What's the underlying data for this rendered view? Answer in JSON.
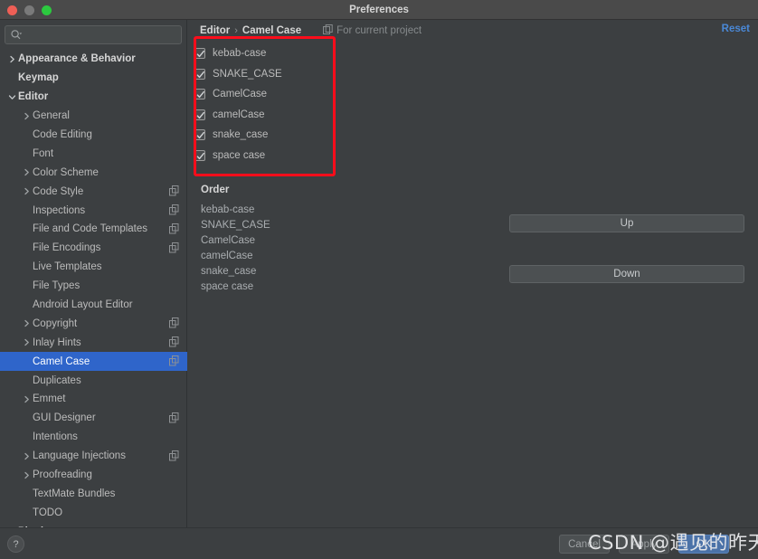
{
  "window": {
    "title": "Preferences",
    "traffic_lights": [
      "close-red",
      "minimize-gray",
      "maximize-green"
    ]
  },
  "sidebar": {
    "search": {
      "value": "",
      "placeholder": "",
      "icon": "search-icon"
    },
    "items": [
      {
        "label": "Appearance & Behavior",
        "indent": 0,
        "twisty": "collapsed",
        "bold": true,
        "cfg": false,
        "selected": false
      },
      {
        "label": "Keymap",
        "indent": 0,
        "twisty": "none",
        "bold": true,
        "cfg": false,
        "selected": false
      },
      {
        "label": "Editor",
        "indent": 0,
        "twisty": "expanded",
        "bold": true,
        "cfg": false,
        "selected": false
      },
      {
        "label": "General",
        "indent": 1,
        "twisty": "collapsed",
        "bold": false,
        "cfg": false,
        "selected": false
      },
      {
        "label": "Code Editing",
        "indent": 1,
        "twisty": "none",
        "bold": false,
        "cfg": false,
        "selected": false
      },
      {
        "label": "Font",
        "indent": 1,
        "twisty": "none",
        "bold": false,
        "cfg": false,
        "selected": false
      },
      {
        "label": "Color Scheme",
        "indent": 1,
        "twisty": "collapsed",
        "bold": false,
        "cfg": false,
        "selected": false
      },
      {
        "label": "Code Style",
        "indent": 1,
        "twisty": "collapsed",
        "bold": false,
        "cfg": true,
        "selected": false
      },
      {
        "label": "Inspections",
        "indent": 1,
        "twisty": "none",
        "bold": false,
        "cfg": true,
        "selected": false
      },
      {
        "label": "File and Code Templates",
        "indent": 1,
        "twisty": "none",
        "bold": false,
        "cfg": true,
        "selected": false
      },
      {
        "label": "File Encodings",
        "indent": 1,
        "twisty": "none",
        "bold": false,
        "cfg": true,
        "selected": false
      },
      {
        "label": "Live Templates",
        "indent": 1,
        "twisty": "none",
        "bold": false,
        "cfg": false,
        "selected": false
      },
      {
        "label": "File Types",
        "indent": 1,
        "twisty": "none",
        "bold": false,
        "cfg": false,
        "selected": false
      },
      {
        "label": "Android Layout Editor",
        "indent": 1,
        "twisty": "none",
        "bold": false,
        "cfg": false,
        "selected": false
      },
      {
        "label": "Copyright",
        "indent": 1,
        "twisty": "collapsed",
        "bold": false,
        "cfg": true,
        "selected": false
      },
      {
        "label": "Inlay Hints",
        "indent": 1,
        "twisty": "collapsed",
        "bold": false,
        "cfg": true,
        "selected": false
      },
      {
        "label": "Camel Case",
        "indent": 1,
        "twisty": "none",
        "bold": false,
        "cfg": true,
        "selected": true
      },
      {
        "label": "Duplicates",
        "indent": 1,
        "twisty": "none",
        "bold": false,
        "cfg": false,
        "selected": false
      },
      {
        "label": "Emmet",
        "indent": 1,
        "twisty": "collapsed",
        "bold": false,
        "cfg": false,
        "selected": false
      },
      {
        "label": "GUI Designer",
        "indent": 1,
        "twisty": "none",
        "bold": false,
        "cfg": true,
        "selected": false
      },
      {
        "label": "Intentions",
        "indent": 1,
        "twisty": "none",
        "bold": false,
        "cfg": false,
        "selected": false
      },
      {
        "label": "Language Injections",
        "indent": 1,
        "twisty": "collapsed",
        "bold": false,
        "cfg": true,
        "selected": false
      },
      {
        "label": "Proofreading",
        "indent": 1,
        "twisty": "collapsed",
        "bold": false,
        "cfg": false,
        "selected": false
      },
      {
        "label": "TextMate Bundles",
        "indent": 1,
        "twisty": "none",
        "bold": false,
        "cfg": false,
        "selected": false
      },
      {
        "label": "TODO",
        "indent": 1,
        "twisty": "none",
        "bold": false,
        "cfg": false,
        "selected": false
      },
      {
        "label": "Plugins",
        "indent": 0,
        "twisty": "none",
        "bold": true,
        "cfg": false,
        "selected": false
      }
    ]
  },
  "content": {
    "breadcrumb": {
      "parent": "Editor",
      "separator": "›",
      "current": "Camel Case"
    },
    "scope_label": "For current project",
    "scope_icon": "project-scope-icon",
    "reset_label": "Reset",
    "checkboxes": [
      {
        "label": "kebab-case",
        "checked": true
      },
      {
        "label": "SNAKE_CASE",
        "checked": true
      },
      {
        "label": "CamelCase",
        "checked": true
      },
      {
        "label": "camelCase",
        "checked": true
      },
      {
        "label": "snake_case",
        "checked": true
      },
      {
        "label": "space case",
        "checked": true
      }
    ],
    "order_title": "Order",
    "order_items": [
      "kebab-case",
      "SNAKE_CASE",
      "CamelCase",
      "camelCase",
      "snake_case",
      "space case"
    ],
    "up_label": "Up",
    "down_label": "Down",
    "annotation_color": "#fd0d1b"
  },
  "footer": {
    "help_label": "?",
    "cancel_label": "Cancel",
    "apply_label": "Apply",
    "ok_label": "OK"
  },
  "overlay": {
    "watermark": "CSDN @遇见的昨天"
  },
  "colors": {
    "window_bg": "#3c3f41",
    "titlebar_bg": "#4a4a4a",
    "selection_blue": "#2f65ca",
    "link_blue": "#4a88d6",
    "ok_button_blue": "#4b72a8",
    "text_primary": "#bbbbbb",
    "text_dim": "#868a8c",
    "annotation_red": "#fd0d1b"
  }
}
